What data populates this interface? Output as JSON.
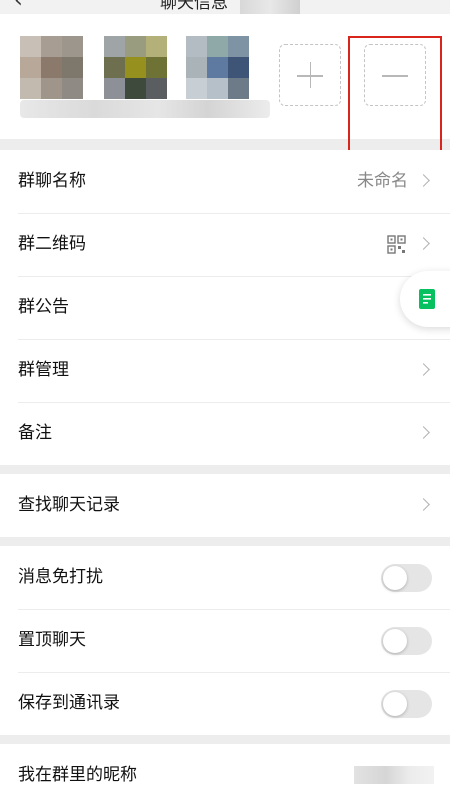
{
  "header": {
    "back_icon": "back-arrow-icon",
    "title_fragment": "聊天信息"
  },
  "members": {
    "add_icon": "plus-icon",
    "remove_icon": "minus-icon",
    "highlight_color": "#d9261c"
  },
  "group1": {
    "items": [
      {
        "label": "群聊名称",
        "value": "未命名"
      },
      {
        "label": "群二维码",
        "icon": "qr-code-icon"
      },
      {
        "label": "群公告"
      },
      {
        "label": "群管理"
      },
      {
        "label": "备注"
      }
    ]
  },
  "group2": {
    "items": [
      {
        "label": "查找聊天记录"
      }
    ]
  },
  "group3": {
    "items": [
      {
        "label": "消息免打扰",
        "on": false
      },
      {
        "label": "置顶聊天",
        "on": false
      },
      {
        "label": "保存到通讯录",
        "on": false
      }
    ]
  },
  "group4": {
    "items": [
      {
        "label": "我在群里的昵称"
      }
    ]
  },
  "floating": {
    "icon": "notes-icon",
    "color": "#07c160"
  }
}
